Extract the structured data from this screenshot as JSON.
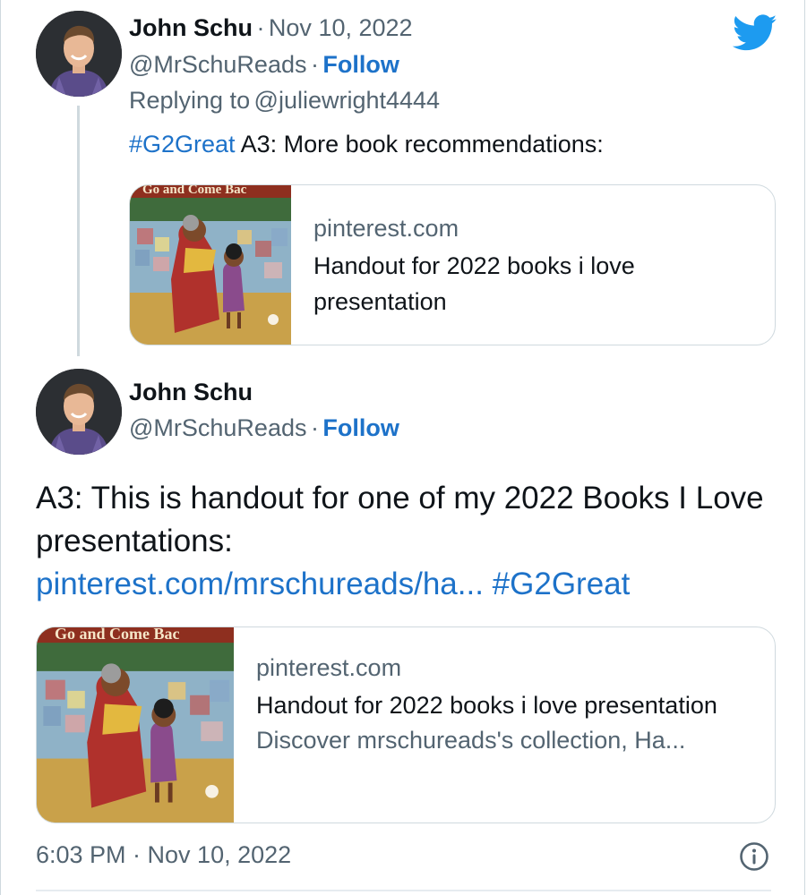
{
  "tweet1": {
    "author_name": "John Schu",
    "separator": "·",
    "date": "Nov 10, 2022",
    "handle": "@MrSchuReads",
    "follow_label": "Follow",
    "replying_prefix": "Replying to",
    "replying_to": "@juliewright4444",
    "hashtag": "#G2Great",
    "text": " A3: More book recommendations:",
    "card": {
      "thumb_caption": "Go and Come Bac",
      "domain": "pinterest.com",
      "title": "Handout for 2022 books i love presentation"
    }
  },
  "tweet2": {
    "author_name": "John Schu",
    "handle": "@MrSchuReads",
    "separator": "·",
    "follow_label": "Follow",
    "text": "A3: This is handout for one of my 2022 Books I Love presentations:",
    "link": "pinterest.com/mrschureads/ha...",
    "hashtag": "#G2Great",
    "card": {
      "thumb_caption": "Go and Come Bac",
      "domain": "pinterest.com",
      "title": "Handout for 2022 books i love presentation",
      "description": "Discover mrschureads's collection, Ha..."
    },
    "timestamp": "6:03 PM · Nov 10, 2022"
  },
  "icons": {
    "brand": "twitter-bird-icon",
    "info": "info-icon"
  },
  "colors": {
    "link": "#1d72c9",
    "twitter_blue": "#1d9bf0",
    "muted": "#536471",
    "border": "#cfd9de"
  }
}
